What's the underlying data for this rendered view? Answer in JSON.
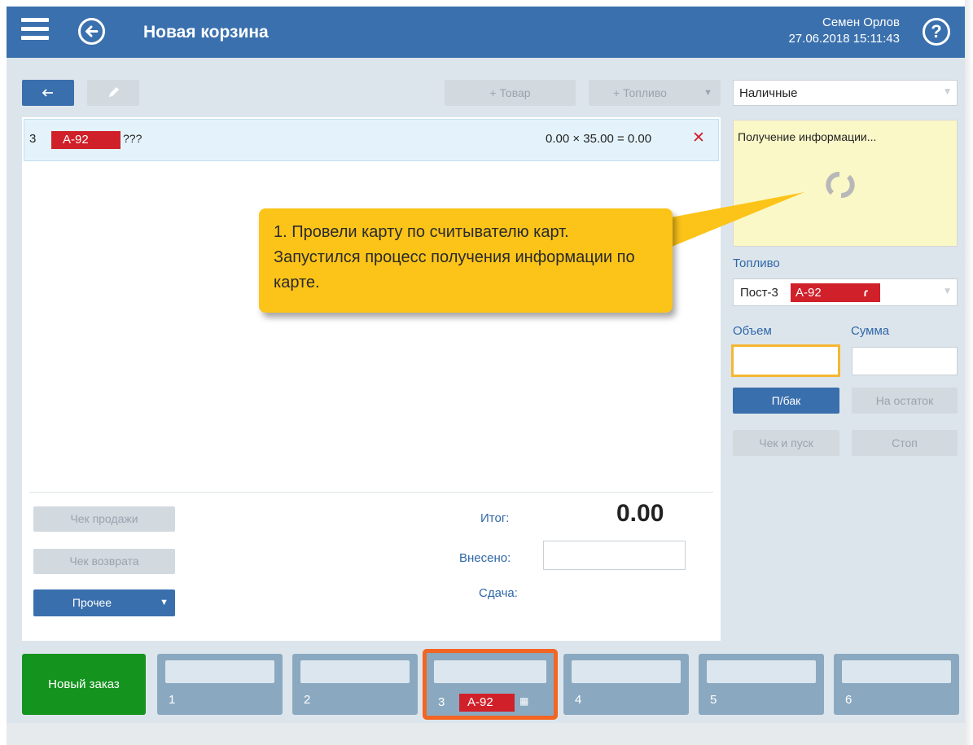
{
  "header": {
    "title": "Новая корзина",
    "user_name": "Семен Орлов",
    "datetime": "27.06.2018 15:11:43",
    "help_symbol": "?"
  },
  "toolbar": {
    "add_product_label": "+ Товар",
    "add_fuel_label": "+ Топливо"
  },
  "payment": {
    "selected": "Наличные"
  },
  "basket": {
    "row": {
      "pump": "3",
      "fuel": "А-92",
      "name": "???",
      "calc": "0.00 × 35.00 = 0.00",
      "remove": "✕"
    }
  },
  "info_box": {
    "text": "Получение информации..."
  },
  "callout": {
    "text": "1. Провели карту по считывателю карт. Запустился процесс получения информации по карте."
  },
  "fuel_panel": {
    "label": "Топливо",
    "post": "Пост-3",
    "fuel": "А-92",
    "volume_label": "Объем",
    "sum_label": "Сумма",
    "volume_value": "",
    "sum_value": "",
    "full_tank_label": "П/бак",
    "remainder_label": "На остаток",
    "receipt_start_label": "Чек и пуск",
    "stop_label": "Стоп"
  },
  "totals": {
    "total_label": "Итог:",
    "total_value": "0.00",
    "paid_label": "Внесено:",
    "paid_value": "",
    "change_label": "Сдача:"
  },
  "actions": {
    "sale_receipt": "Чек продажи",
    "return_receipt": "Чек возврата",
    "other": "Прочее"
  },
  "tabs": {
    "new_order": "Новый заказ",
    "items": [
      {
        "num": "1"
      },
      {
        "num": "2"
      },
      {
        "num": "3",
        "fuel": "А-92",
        "active": true
      },
      {
        "num": "4"
      },
      {
        "num": "5"
      },
      {
        "num": "6"
      }
    ]
  },
  "colors": {
    "header_bg": "#3a70ad",
    "fuel_tag": "#d0202a",
    "callout": "#fcc419",
    "new_order": "#15931f",
    "active_tab_border": "#f26522"
  }
}
